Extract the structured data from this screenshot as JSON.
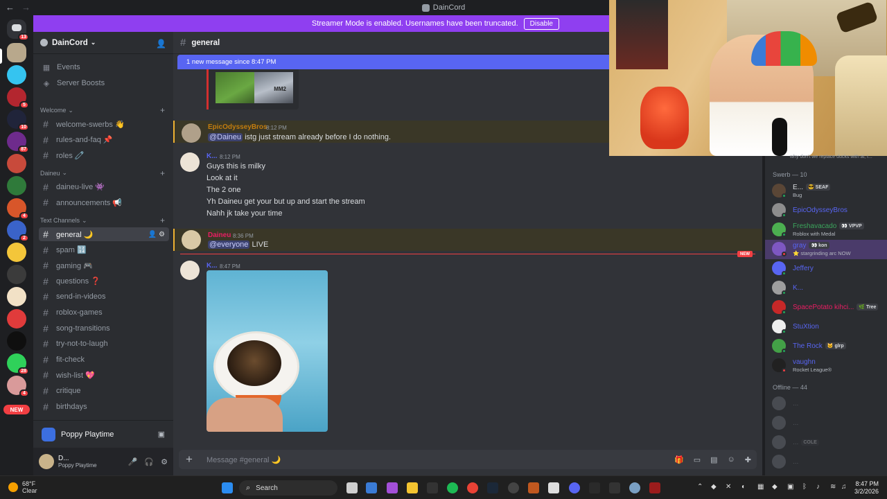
{
  "window": {
    "title": "DainCord"
  },
  "banner": {
    "text": "Streamer Mode is enabled. Usernames have been truncated.",
    "button": "Disable"
  },
  "server_rail": {
    "home_badge": "13",
    "new_label": "NEW",
    "badges": [
      "5",
      "10",
      "87",
      "4",
      "2",
      "4",
      "28",
      "4"
    ]
  },
  "sidebar": {
    "guild": "DainCord",
    "top_items": [
      {
        "icon": "calendar-icon",
        "label": "Events"
      },
      {
        "icon": "boost-icon",
        "label": "Server Boosts"
      }
    ],
    "categories": [
      {
        "name": "Welcome",
        "channels": [
          "welcome-swerbs 👋",
          "rules-and-faq 📌",
          "roles 🧷"
        ]
      },
      {
        "name": "Daineu",
        "channels": [
          "daineu-live 👾",
          "announcements 📢"
        ]
      },
      {
        "name": "Text Channels",
        "channels": [
          "general 🌙",
          "spam 🔢",
          "gaming 🎮",
          "questions ❓",
          "send-in-videos",
          "roblox-games",
          "song-transitions",
          "try-not-to-laugh",
          "fit-check",
          "wish-list 💖",
          "critique",
          "birthdays"
        ]
      }
    ],
    "voice_activity": "Poppy Playtime",
    "user": {
      "name": "D...",
      "status": "Poppy Playtime"
    }
  },
  "chat": {
    "channel": "general",
    "new_bar": "1 new message since 8:47 PM",
    "new_tag": "NEW",
    "embed_tag": "MM2",
    "messages": [
      {
        "author": "EpicOdysseyBros",
        "time": "8:12 PM",
        "color": "#c27c0e",
        "lines": [
          {
            "mention": "@Daineu",
            "text": " istg just stream already before I do nothing."
          }
        ]
      },
      {
        "author": "K...",
        "time": "8:12 PM",
        "color": "#5865f2",
        "lines": [
          {
            "text": "Guys this is milky"
          },
          {
            "text": "Look at it"
          },
          {
            "text": "The 2 one"
          },
          {
            "text": "Yh Daineu get your but up and start the stream"
          },
          {
            "text": "Nahh jk take your time"
          }
        ]
      },
      {
        "author": "Daineu",
        "time": "8:36 PM",
        "color": "#e91e63",
        "lines": [
          {
            "mention": "@everyone",
            "text": " LIVE"
          }
        ]
      },
      {
        "author": "K...",
        "time": "8:47 PM",
        "color": "#5865f2",
        "lines": []
      }
    ],
    "composer": {
      "placeholder": "Message #general 🌙"
    }
  },
  "members": {
    "sections": [
      {
        "title": "Swerb — 10",
        "items": [
          {
            "name": "E...",
            "tag": "😎 SEAF",
            "activity": "Bug",
            "color": "#dbdee1",
            "status": "#23a55a"
          },
          {
            "name": "EpicOdysseyBros",
            "tag": "",
            "activity": "",
            "color": "#5865f2",
            "status": "#23a55a"
          },
          {
            "name": "Freshavacado",
            "tag": "👀 VPVP",
            "activity": "Roblox with Medal",
            "color": "#3ba55c",
            "status": "#23a55a"
          },
          {
            "name": "gray",
            "tag": "👀 kon",
            "activity": "⭐ stargrinding arc NOW",
            "color": "#5865f2",
            "status": "#f23f43"
          },
          {
            "name": "Jeffery",
            "tag": "",
            "activity": "",
            "color": "#5865f2",
            "status": "#23a55a"
          },
          {
            "name": "K...",
            "tag": "",
            "activity": "",
            "color": "#5865f2",
            "status": "#23a55a"
          },
          {
            "name": "SpacePotato kihci...",
            "tag": "🌿 Tree",
            "activity": "",
            "color": "#e91e63",
            "status": "#23a55a"
          },
          {
            "name": "StuXtion",
            "tag": "",
            "activity": "",
            "color": "#5865f2",
            "status": "#23a55a"
          },
          {
            "name": "The Rock",
            "tag": "🐱 glrp",
            "activity": "",
            "color": "#5865f2",
            "status": "#23a55a"
          },
          {
            "name": "vaughn",
            "tag": "",
            "activity": "Rocket League®",
            "color": "#5865f2",
            "status": "#f23f43"
          }
        ]
      },
      {
        "title": "Offline — 44",
        "items": [
          {
            "name": "...",
            "tag": "",
            "activity": ""
          },
          {
            "name": "...",
            "tag": "",
            "activity": ""
          },
          {
            "name": "...",
            "tag": "COLE",
            "activity": ""
          },
          {
            "name": "...",
            "tag": "",
            "activity": ""
          }
        ]
      }
    ],
    "caption": "why don't we replace ducks with ai, I..."
  },
  "taskbar": {
    "weather": {
      "temp": "68°F",
      "condition": "Clear"
    },
    "search_label": "Search",
    "time": "8:47 PM",
    "date": "3/2/2026"
  }
}
